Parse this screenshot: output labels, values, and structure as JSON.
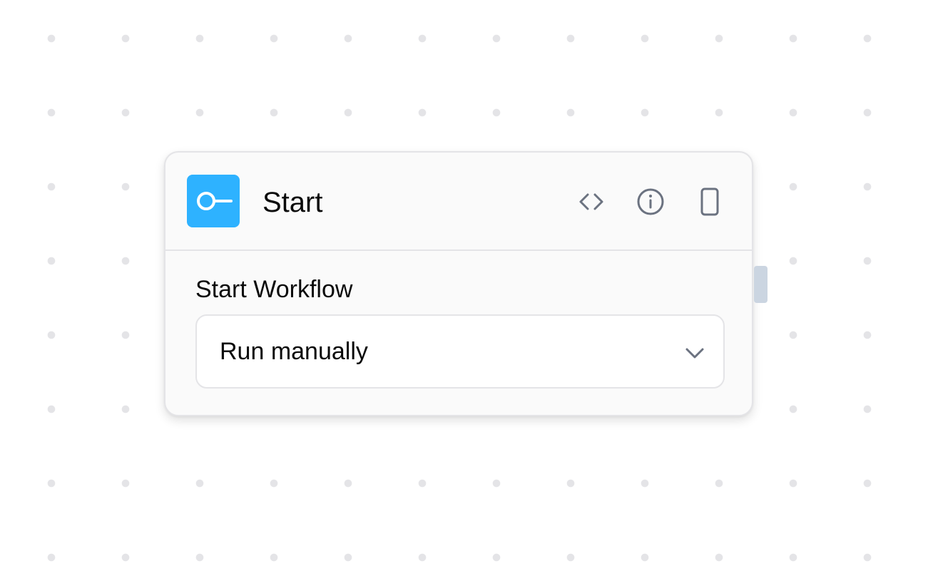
{
  "canvas": {
    "dot_color": "#e4e4e7",
    "background": "#ffffff"
  },
  "node": {
    "title": "Start",
    "icon": "start-node-icon",
    "icon_bg": "#2eb2ff",
    "actions": [
      {
        "name": "code-icon"
      },
      {
        "name": "info-icon"
      },
      {
        "name": "mobile-preview-icon"
      }
    ],
    "field": {
      "label": "Start Workflow",
      "value": "Run manually",
      "control": "dropdown"
    },
    "handle_color": "#cbd5e1"
  }
}
